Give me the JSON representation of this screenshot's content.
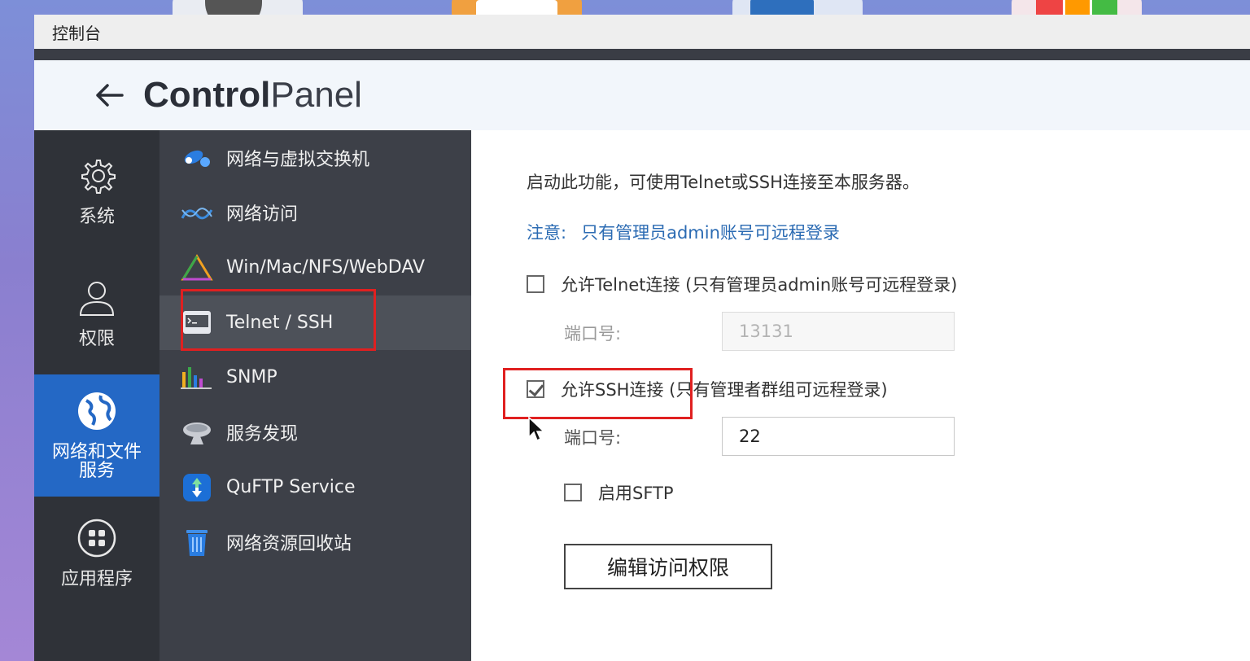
{
  "window": {
    "title_bar": "控制台",
    "header_title_bold": "Control",
    "header_title_light": "Panel"
  },
  "left_nav": {
    "items": [
      {
        "label": "系统",
        "icon": "gear-icon"
      },
      {
        "label": "权限",
        "icon": "user-icon"
      },
      {
        "label": "网络和文件\n服务",
        "icon": "globe-icon",
        "active": true
      },
      {
        "label": "应用程序",
        "icon": "apps-grid-icon"
      }
    ]
  },
  "sub_nav": {
    "items": [
      {
        "label": "网络与虚拟交换机",
        "icon": "network-switch-icon"
      },
      {
        "label": "网络访问",
        "icon": "network-access-icon"
      },
      {
        "label": "Win/Mac/NFS/WebDAV",
        "icon": "file-sharing-icon"
      },
      {
        "label": "Telnet / SSH",
        "icon": "terminal-icon",
        "selected": true
      },
      {
        "label": "SNMP",
        "icon": "snmp-chart-icon"
      },
      {
        "label": "服务发现",
        "icon": "satellite-dish-icon"
      },
      {
        "label": "QuFTP Service",
        "icon": "ftp-icon"
      },
      {
        "label": "网络资源回收站",
        "icon": "recycle-bin-icon"
      }
    ]
  },
  "content": {
    "description": "启动此功能，可使用Telnet或SSH连接至本服务器。",
    "note_label": "注意:",
    "note_text": "只有管理员admin账号可远程登录",
    "telnet_option": {
      "label": "允许Telnet连接 (只有管理员admin账号可远程登录)",
      "checked": false
    },
    "telnet_port_label": "端口号:",
    "telnet_port_value": "13131",
    "ssh_option": {
      "label": "允许SSH连接 (只有管理者群组可远程登录)",
      "checked": true
    },
    "ssh_port_label": "端口号:",
    "ssh_port_value": "22",
    "sftp_option": {
      "label": "启用SFTP",
      "checked": false
    },
    "edit_button": "编辑访问权限"
  },
  "colors": {
    "accent": "#2468c5",
    "highlight": "#e02020",
    "left_nav_bg": "#2f3238",
    "sub_nav_bg": "#3d4048",
    "note_color": "#2b6bb3"
  }
}
